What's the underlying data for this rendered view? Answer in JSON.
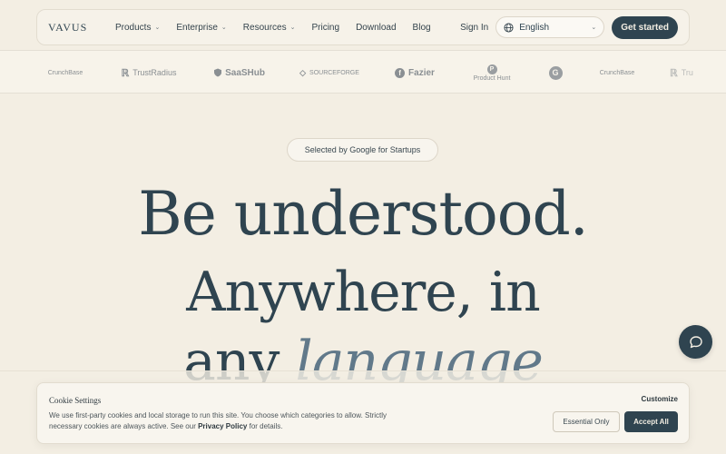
{
  "nav": {
    "logo": "VAVUS",
    "items": [
      {
        "label": "Products",
        "dropdown": true
      },
      {
        "label": "Enterprise",
        "dropdown": true
      },
      {
        "label": "Resources",
        "dropdown": true
      },
      {
        "label": "Pricing",
        "dropdown": false
      },
      {
        "label": "Download",
        "dropdown": false
      },
      {
        "label": "Blog",
        "dropdown": false
      }
    ],
    "signin": "Sign In",
    "language": "English",
    "cta": "Get started"
  },
  "strip": {
    "logos": [
      {
        "name": "CrunchBase",
        "icon": "crunchbase-icon"
      },
      {
        "name": "TrustRadius",
        "icon": "trustradius-icon"
      },
      {
        "name": "SaaSHub",
        "icon": "shield-icon"
      },
      {
        "name": "SOURCEFORGE",
        "icon": "diamond-icon"
      },
      {
        "name": "Fazier",
        "icon": "fazier-icon"
      },
      {
        "name": "Product Hunt",
        "icon": "producthunt-icon"
      },
      {
        "name": "",
        "icon": "g2-icon"
      },
      {
        "name": "CrunchBase",
        "icon": "crunchbase-icon"
      },
      {
        "name": "Tru",
        "icon": "trustradius-icon"
      }
    ]
  },
  "badge": "Selected by Google for Startups",
  "hero": {
    "line1": "Be understood.",
    "line2": "Anywhere, in",
    "line3_prefix": "any",
    "line3_emphasis": "language"
  },
  "cookie": {
    "title": "Cookie Settings",
    "text_before": "We use first-party cookies and local storage to run this site. You choose which categories to allow. Strictly necessary cookies are always active. See our",
    "privacy_link": "Privacy Policy",
    "text_after": "for details.",
    "customize": "Customize",
    "essential": "Essential Only",
    "accept": "Accept All"
  },
  "colors": {
    "background": "#f3eee3",
    "primary": "#2f4450",
    "accent_italic": "#61798a"
  }
}
